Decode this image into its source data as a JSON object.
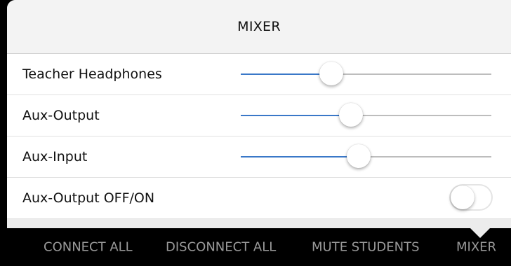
{
  "mixer": {
    "title": "MIXER",
    "rows": [
      {
        "label": "Teacher Headphones",
        "value_fraction": 0.36
      },
      {
        "label": "Aux-Output",
        "value_fraction": 0.44
      },
      {
        "label": "Aux-Input",
        "value_fraction": 0.47
      },
      {
        "label": "Aux-Output OFF/ON",
        "toggle_on": false
      }
    ]
  },
  "toolbar": {
    "buttons": [
      {
        "label": "CONNECT ALL"
      },
      {
        "label": "DISCONNECT ALL"
      },
      {
        "label": "MUTE STUDENTS"
      },
      {
        "label": "MIXER"
      }
    ]
  },
  "colors": {
    "slider_fill": "#3a78c8",
    "slider_track": "#bdbdbd",
    "toolbar_text": "#9a9a9a",
    "toolbar_bg": "#000000"
  }
}
